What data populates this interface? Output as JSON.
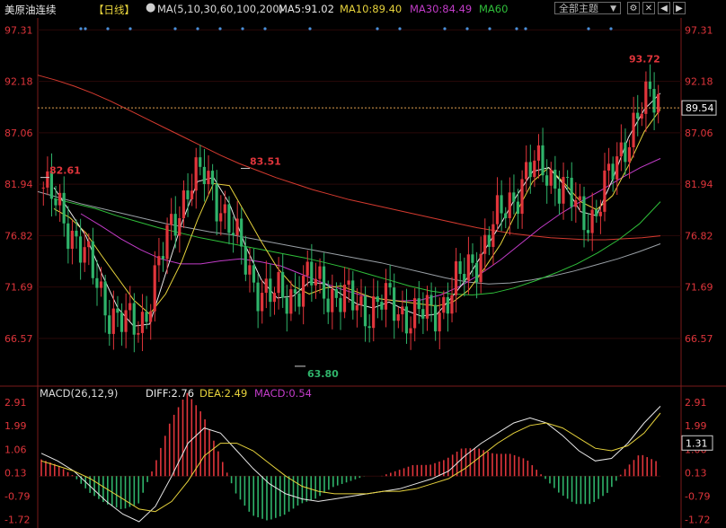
{
  "header": {
    "title": "美原油连续",
    "period": "【日线】",
    "ma_label": "MA(5,10,30,60,100,200)",
    "ma5": "MA5:91.02",
    "ma10": "MA10:89.40",
    "ma30": "MA30:84.49",
    "ma60": "MA60",
    "dropdown": "全部主题",
    "colors": {
      "ma5": "#e8e8e8",
      "ma10": "#e6d23c",
      "ma30": "#c23cc8",
      "ma60": "#2fbf3a",
      "ma200": "#d43a2f",
      "up": "#e0353b",
      "down": "#2fb36a"
    }
  },
  "macd_header": {
    "label": "MACD(26,12,9)",
    "diff": "DIFF:2.76",
    "dea": "DEA:2.49",
    "macd": "MACD:0.54"
  },
  "chart_data": [
    {
      "type": "candlestick",
      "y_ticks": [
        "97.31",
        "92.18",
        "87.06",
        "81.94",
        "76.82",
        "71.69",
        "66.57"
      ],
      "ylim": [
        62.0,
        98.5
      ],
      "current_price": "89.54",
      "annotations": [
        {
          "text": "82.61",
          "value": 82.61
        },
        {
          "text": "83.51",
          "value": 83.51
        },
        {
          "text": "63.80",
          "value": 63.8
        },
        {
          "text": "93.72",
          "value": 93.72
        }
      ],
      "series": [
        {
          "name": "MA200",
          "values": [
            92.8,
            92.3,
            91.7,
            91.0,
            90.2,
            89.3,
            88.4,
            87.5,
            86.6,
            85.7,
            84.8,
            84.0,
            83.3,
            82.6,
            82.0,
            81.4,
            80.9,
            80.4,
            80.0,
            79.6,
            79.2,
            78.8,
            78.4,
            78.0,
            77.6,
            77.3,
            77.0,
            76.8,
            76.6,
            76.5,
            76.4,
            76.4,
            76.5,
            76.6,
            76.8
          ]
        },
        {
          "name": "MA100",
          "values": [
            81.2,
            80.6,
            80.0,
            79.5,
            79.0,
            78.5,
            78.0,
            77.6,
            77.2,
            76.9,
            76.5,
            76.1,
            75.7,
            75.3,
            74.9,
            74.5,
            74.1,
            73.6,
            73.1,
            72.6,
            72.2,
            72.0,
            72.1,
            72.4,
            72.8,
            73.3,
            73.9,
            74.5,
            75.2,
            76.0
          ]
        },
        {
          "name": "MA60",
          "values": [
            80.5,
            80.0,
            79.5,
            78.8,
            78.2,
            77.6,
            77.1,
            76.6,
            76.2,
            75.8,
            75.4,
            75.0,
            74.6,
            74.1,
            73.6,
            73.0,
            72.4,
            71.8,
            71.3,
            71.0,
            70.9,
            71.1,
            71.6,
            72.3,
            73.1,
            74.0,
            75.1,
            76.4,
            78.0,
            80.2
          ]
        },
        {
          "name": "MA30",
          "values": [
            79.0,
            77.8,
            76.5,
            75.4,
            74.5,
            74.0,
            74.0,
            74.3,
            74.5,
            74.2,
            73.8,
            73.0,
            72.2,
            71.5,
            70.9,
            70.5,
            70.3,
            70.4,
            70.9,
            71.8,
            73.0,
            74.4,
            76.0,
            77.6,
            79.0,
            80.2,
            81.3,
            82.5,
            83.6,
            84.5
          ]
        },
        {
          "name": "MA10",
          "values": [
            79.5,
            78.6,
            77.1,
            74.8,
            72.6,
            70.4,
            69.0,
            71.0,
            74.2,
            78.4,
            82.0,
            81.8,
            79.0,
            76.2,
            73.6,
            71.8,
            71.0,
            71.6,
            71.8,
            71.2,
            70.6,
            70.4,
            70.2,
            70.0,
            69.8,
            70.2,
            71.4,
            73.6,
            76.0,
            79.2,
            82.2,
            83.6,
            82.0,
            80.2,
            79.4,
            80.8,
            83.8,
            87.2,
            89.4
          ]
        },
        {
          "name": "MA5",
          "values": [
            81.6,
            79.2,
            76.8,
            73.0,
            69.6,
            67.8,
            68.0,
            73.0,
            78.0,
            82.2,
            82.6,
            80.0,
            75.8,
            72.4,
            70.6,
            70.8,
            72.2,
            72.0,
            71.0,
            70.0,
            69.6,
            70.2,
            69.4,
            68.8,
            69.0,
            70.8,
            72.8,
            75.4,
            78.0,
            80.8,
            83.2,
            83.6,
            81.8,
            79.2,
            78.8,
            82.4,
            86.6,
            89.4,
            91.0
          ]
        }
      ]
    },
    {
      "type": "macd",
      "y_ticks": [
        "2.91",
        "1.99",
        "1.06",
        "0.13",
        "-0.79",
        "-1.72"
      ],
      "ylim": [
        -2.05,
        3.2
      ],
      "current_value": "1.31",
      "diff": [
        0.9,
        0.6,
        0.2,
        -0.4,
        -1.0,
        -1.5,
        -1.8,
        -1.2,
        0.0,
        1.3,
        1.9,
        1.7,
        1.0,
        0.3,
        -0.3,
        -0.7,
        -0.9,
        -1.0,
        -0.9,
        -0.8,
        -0.7,
        -0.6,
        -0.5,
        -0.3,
        -0.1,
        0.2,
        0.8,
        1.3,
        1.7,
        2.1,
        2.3,
        2.1,
        1.6,
        1.0,
        0.6,
        0.7,
        1.3,
        2.1,
        2.76
      ],
      "dea": [
        0.6,
        0.4,
        0.2,
        -0.1,
        -0.5,
        -0.9,
        -1.3,
        -1.4,
        -1.0,
        -0.2,
        0.8,
        1.3,
        1.3,
        1.0,
        0.5,
        0.0,
        -0.4,
        -0.6,
        -0.7,
        -0.7,
        -0.7,
        -0.6,
        -0.6,
        -0.5,
        -0.3,
        -0.1,
        0.3,
        0.8,
        1.3,
        1.7,
        2.0,
        2.1,
        1.9,
        1.5,
        1.1,
        1.0,
        1.2,
        1.7,
        2.49
      ]
    }
  ]
}
